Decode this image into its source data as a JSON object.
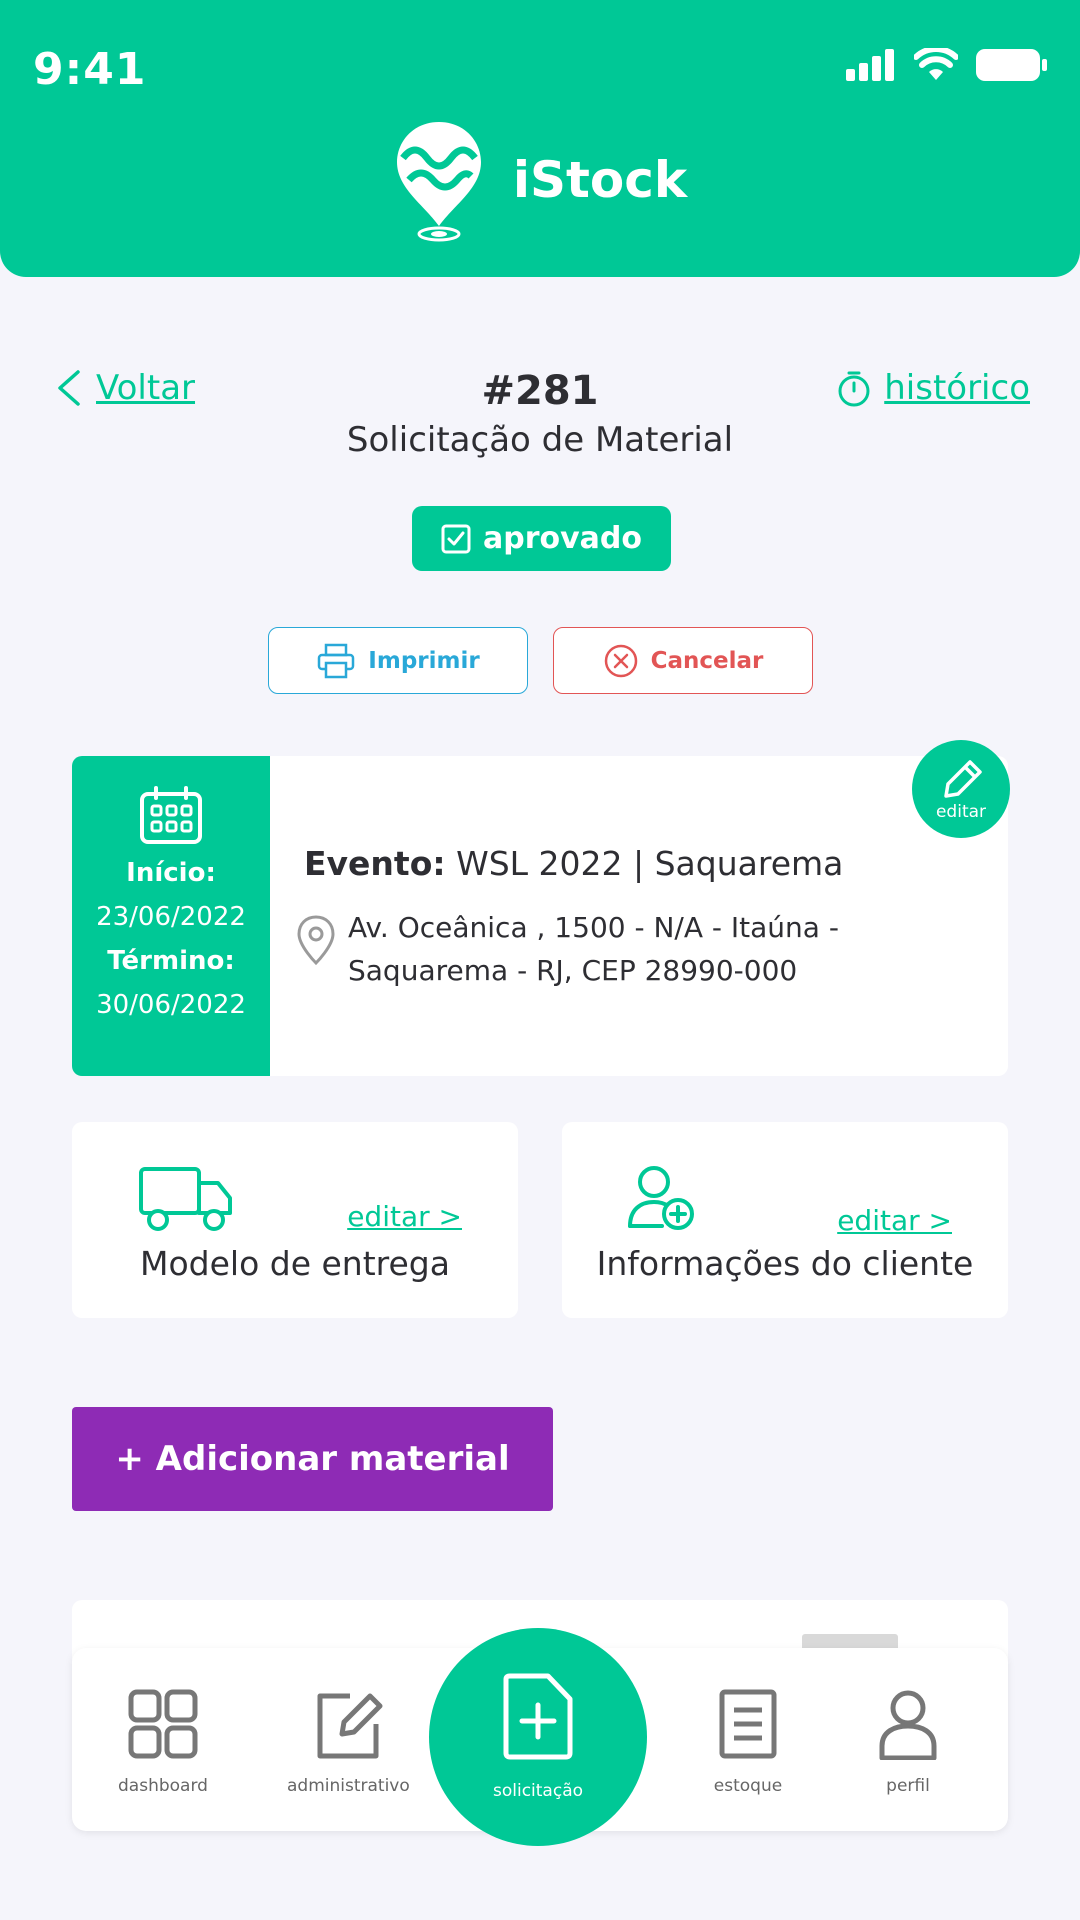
{
  "status_bar": {
    "time": "9:41"
  },
  "app": {
    "name": "iStock"
  },
  "nav": {
    "back_label": "Voltar",
    "history_label": "histórico"
  },
  "request": {
    "id": "#281",
    "type": "Solicitação de Material",
    "status": "aprovado"
  },
  "actions": {
    "print_label": "Imprimir",
    "cancel_label": "Cancelar"
  },
  "event": {
    "start_label": "Início:",
    "start_date": "23/06/2022",
    "end_label": "Término:",
    "end_date": "30/06/2022",
    "title_label": "Evento:",
    "title_value": "WSL 2022 | Saquarema",
    "address_line1": "Av. Oceânica , 1500 - N/A - Itaúna -",
    "address_line2": "Saquarema - RJ, CEP 28990-000",
    "edit_label": "editar"
  },
  "cards": {
    "delivery": {
      "title": "Modelo de entrega",
      "edit_label": "editar >"
    },
    "client": {
      "title": "Informações do cliente",
      "edit_label": "editar >"
    }
  },
  "add_material_label": "+ Adicionar material",
  "bottom_nav": {
    "dashboard": "dashboard",
    "admin": "administrativo",
    "request": "solicitação",
    "stock": "estoque",
    "profile": "perfil"
  },
  "colors": {
    "primary": "#00c896",
    "purple": "#8e2bb5",
    "blue": "#29a8d8",
    "red": "#e25555"
  }
}
